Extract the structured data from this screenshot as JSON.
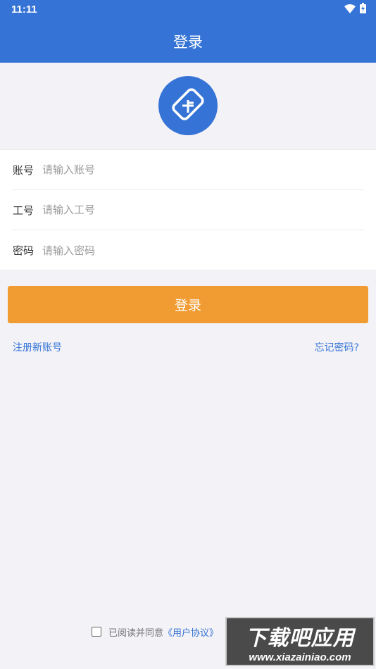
{
  "status_bar": {
    "time": "11:11",
    "icons": [
      "wifi-icon",
      "battery-icon"
    ]
  },
  "header": {
    "title": "登录"
  },
  "logo": {
    "icon": "card-icon"
  },
  "form": {
    "fields": [
      {
        "label": "账号",
        "placeholder": "请输入账号",
        "value": ""
      },
      {
        "label": "工号",
        "placeholder": "请输入工号",
        "value": ""
      },
      {
        "label": "密码",
        "placeholder": "请输入密码",
        "value": ""
      }
    ]
  },
  "actions": {
    "login_label": "登录",
    "register_label": "注册新账号",
    "forgot_label": "忘记密码?"
  },
  "agreement": {
    "checked": false,
    "text": "已阅读并同意",
    "link": "《用户协议》"
  },
  "watermark": {
    "title": "下载吧应用",
    "url": "www.xiazainiao.com"
  },
  "colors": {
    "primary": "#3574d6",
    "accent": "#f09c32",
    "background": "#f3f2f7"
  }
}
